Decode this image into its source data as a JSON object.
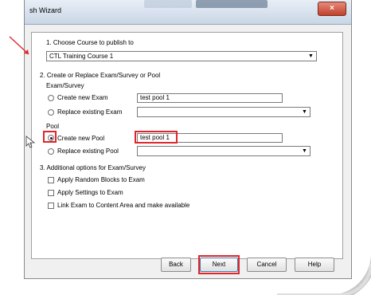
{
  "window": {
    "title": "sh Wizard",
    "close_glyph": "×"
  },
  "step1": {
    "label": "1. Choose Course to publish to",
    "course_value": "CTL Training Course 1"
  },
  "step2": {
    "label": "2. Create or Replace Exam/Survey or Pool",
    "exam_section": "Exam/Survey",
    "create_exam_label": "Create new Exam",
    "create_exam_value": "test pool 1",
    "replace_exam_label": "Replace existing Exam",
    "pool_section": "Pool",
    "create_pool_label": "Create new Pool",
    "create_pool_value": "test pool 1",
    "replace_pool_label": "Replace existing Pool"
  },
  "step3": {
    "label": "3. Additional options for Exam/Survey",
    "option1": "Apply Random Blocks to Exam",
    "option2": "Apply Settings to Exam",
    "option3": "Link Exam to Content Area and make available"
  },
  "buttons": {
    "back": "Back",
    "next": "Next",
    "cancel": "Cancel",
    "help": "Help"
  },
  "colors": {
    "highlight": "#e0262c"
  }
}
